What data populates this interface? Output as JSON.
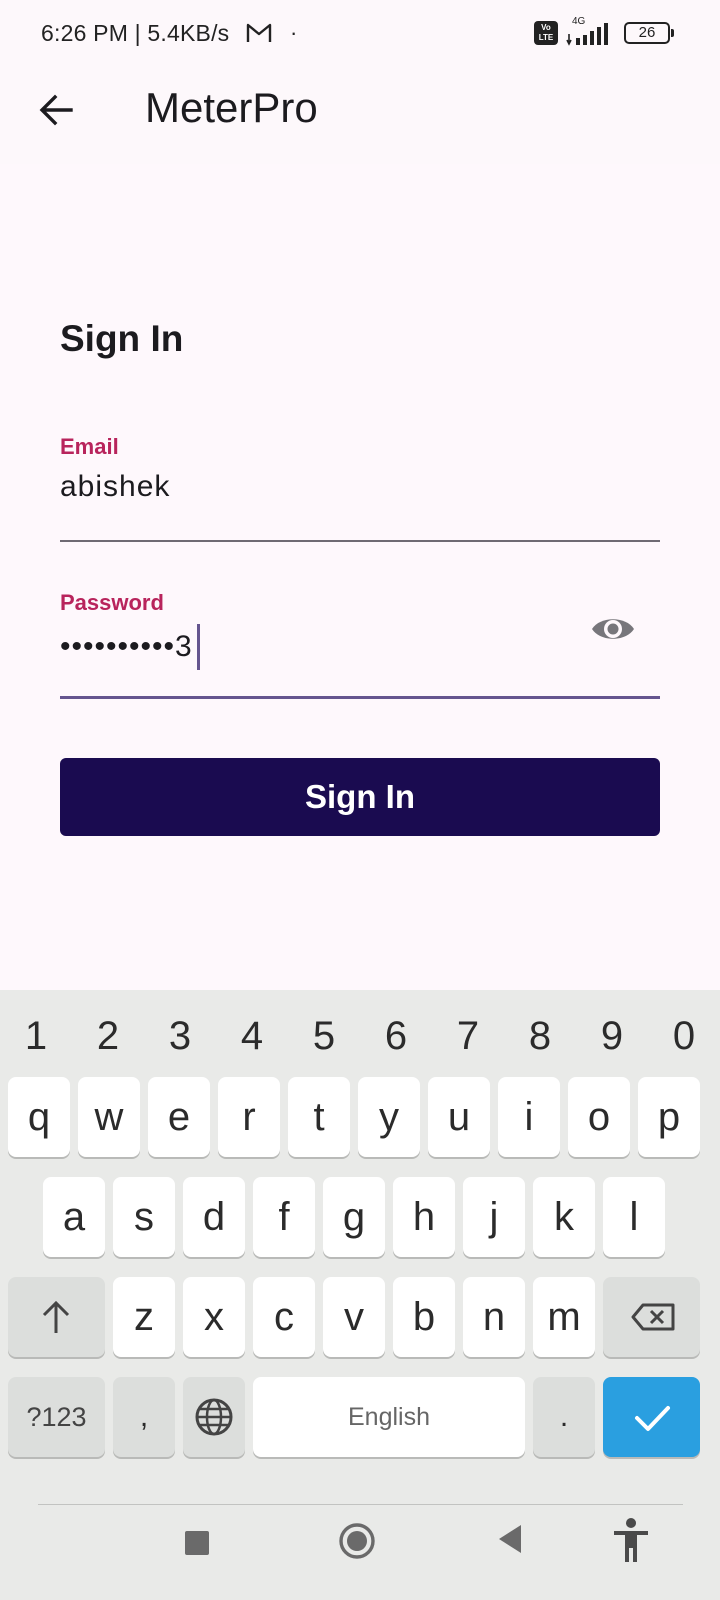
{
  "status_bar": {
    "time": "6:26 PM | 5.4KB/s",
    "volte_top": "Vo",
    "volte_bottom": "LTE",
    "network": "4G",
    "battery": "26"
  },
  "app_bar": {
    "title": "MeterPro"
  },
  "form": {
    "heading": "Sign In",
    "email_label": "Email",
    "email_value": "abishek",
    "password_label": "Password",
    "password_value": "••••••••••3",
    "submit_label": "Sign In"
  },
  "keyboard": {
    "numbers": [
      "1",
      "2",
      "3",
      "4",
      "5",
      "6",
      "7",
      "8",
      "9",
      "0"
    ],
    "row1": [
      "q",
      "w",
      "e",
      "r",
      "t",
      "y",
      "u",
      "i",
      "o",
      "p"
    ],
    "row2": [
      "a",
      "s",
      "d",
      "f",
      "g",
      "h",
      "j",
      "k",
      "l"
    ],
    "row3": [
      "z",
      "x",
      "c",
      "v",
      "b",
      "n",
      "m"
    ],
    "symbols_label": "?123",
    "comma_label": ",",
    "space_label": "English",
    "period_label": "."
  },
  "colors": {
    "label_accent": "#b8245c",
    "button_bg": "#1a0b50",
    "keyboard_enter": "#2a9fe0"
  }
}
